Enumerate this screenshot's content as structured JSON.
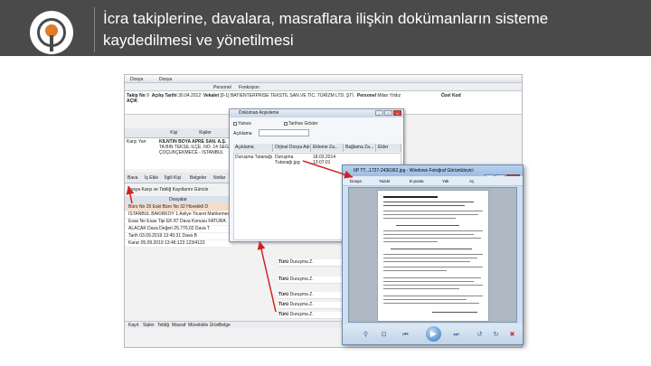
{
  "slide": {
    "title": "İcra takiplerine, davalara, masraflara ilişkin dokümanların sisteme kaydedilmesi ve yönetilmesi"
  },
  "colors": {
    "header_bg": "#4a4a4a",
    "accent": "#e07b2a",
    "arrow": "#d32020"
  },
  "app": {
    "menu": [
      "Dosya",
      "Dosya"
    ],
    "toolbar2": [
      "Personel",
      "Fonksiyon"
    ],
    "info": {
      "takip_label": "Takip No",
      "takip_value": "9",
      "acilis_label": "Açılış Tarihi",
      "acilis_value": "30.04.2012",
      "vekalet_label": "Vekalet",
      "vekalet_value": "[9-1]",
      "vekalet_text": "BATIENTERPRISE TEKSTİL SAN.VE TİC. TÜRİZM LTD. ŞTİ.",
      "personel_label": "Personel",
      "personel_value": "Milan Yıldız",
      "ozel_kod_label": "Özel Kod",
      "durum": "AÇIK"
    },
    "left": {
      "kisi_tab": "Kişi Tab",
      "kisiler": "Kişiler",
      "karsi_yan": "Karşı Yan",
      "party_name": "KİLNTİN BOYA APRE SAN. A.Ş.",
      "party_addr1": "TA BİN TEKSİL İLÇE, NO. 14 SEG",
      "party_addr2": "ÇOÇUKÇEKMECE - İSTANBUL",
      "buttons": [
        "Bava",
        "İş Ekle",
        "İlgili Kişi",
        "Belgeler",
        "Notlar"
      ],
      "links_row": "Dosya Karşı ve Tebliğ Kayıtlarını Güncle",
      "dosyalar": "Dosyalar",
      "rows": [
        "Büro No 20  Eski Büro No 32  Hüvekkil D",
        "İSTANBUL BAKIRKÖY 1.Asliye Ticaret Mahkemesi",
        "Esas No  Esas Tipi  EK 87  Dava Konusu FATURA",
        "ALACAK  Dava Değeri 25.776,02  Dava T",
        "Tarih 03.09.2019 13:45:31  Dava B",
        "Karar 05.09.2019 13:46:123  123/4123"
      ]
    },
    "bottom_links": [
      "Kayıt",
      "Sipler",
      "Tebliğ",
      "Masraf",
      "Müvekkile Ürün",
      "Belge"
    ],
    "right_list": [
      {
        "label": "Türü",
        "value": "Duruşma Z."
      },
      {
        "label": "Türü",
        "value": "Duruşma Z."
      },
      {
        "label": "Türü",
        "value": "Duruşma Z."
      },
      {
        "label": "Türü",
        "value": "Duruşma Z."
      },
      {
        "label": "Türü",
        "value": "Duruşma Z."
      }
    ]
  },
  "dialog": {
    "title": "Doküman Arşivleme",
    "chk1": "Yansıs",
    "chk2": "Tarihse Göster",
    "aciklama_label": "Açıklama",
    "columns": [
      "Açıklama",
      "Orjinal Dosya Adı",
      "Ekleme Za...",
      "Bağlama Za...",
      "Ekler"
    ],
    "row": {
      "aciklama": "Duruşma Tutanağı",
      "dosya_adi1": "Duruşma",
      "dosya_adi2": "Tutanağı.jpg",
      "ekleme1": "18.03.2014",
      "ekleme2": "13:07:01"
    }
  },
  "viewer": {
    "title": "IIP TT...1727-2436362.jpg - Windows Fotoğraf Görüntüleyici",
    "menu": [
      "Dosya",
      "Yazdır",
      "E-posta",
      "Yak",
      "Aç"
    ]
  }
}
